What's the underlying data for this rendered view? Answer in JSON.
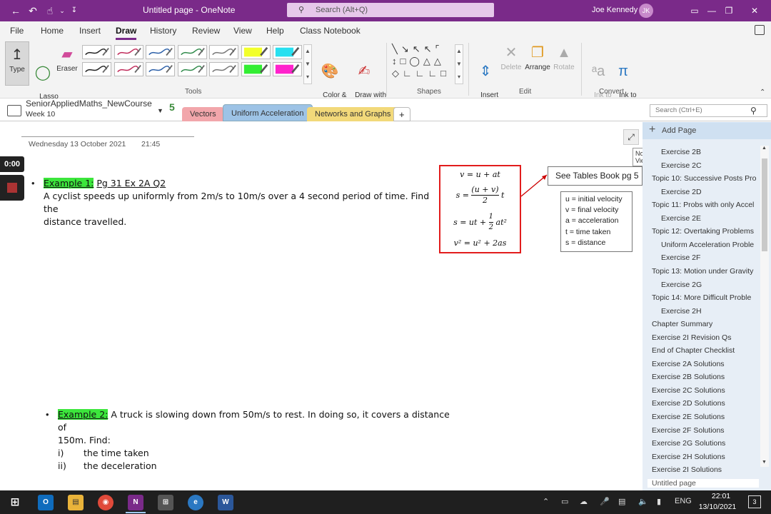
{
  "titlebar": {
    "title": "Untitled page  -  OneNote",
    "search_placeholder": "Search (Alt+Q)",
    "user": "Joe Kennedy",
    "initials": "JK"
  },
  "menu": {
    "tabs": [
      "File",
      "Home",
      "Insert",
      "Draw",
      "History",
      "Review",
      "View",
      "Help",
      "Class Notebook"
    ],
    "active": "Draw"
  },
  "ribbon": {
    "type": "Type",
    "lasso": "Lasso\nSelect",
    "eraser": "Eraser",
    "color_thickness": "Color &\nThickness",
    "draw_touch": "Draw with\nTouch",
    "insert_space": "Insert\nSpace",
    "delete": "Delete",
    "arrange": "Arrange",
    "rotate": "Rotate",
    "ink_text": "Ink to\nText",
    "ink_math": "Ink to\nMath",
    "groups": {
      "tools": "Tools",
      "shapes": "Shapes",
      "edit": "Edit",
      "convert": "Convert"
    }
  },
  "notebook": {
    "name": "SeniorAppliedMaths_NewCourse",
    "section": "Week 10",
    "sections": [
      "Vectors",
      "Uniform Acceleration",
      "Networks and Graphs"
    ],
    "active_section": "Uniform Acceleration",
    "search_placeholder": "Search (Ctrl+E)"
  },
  "page": {
    "date": "Wednesday 13 October 2021",
    "time": "21:45",
    "timer": "0:00",
    "tooltip": "Normal View",
    "example1": {
      "label": "Example 1:",
      "ref": "Pg 31 Ex 2A Q2",
      "line1": "A cyclist speeds up uniformly from 2m/s to 10m/s over a 4 second period of time. Find the",
      "line2": "distance travelled."
    },
    "example2": {
      "label": "Example 2:",
      "line1": "A truck is slowing down from 50m/s to rest. In doing so, it covers a distance of",
      "line2": "150m. Find:",
      "i": "i)",
      "i_text": "the time taken",
      "ii": "ii)",
      "ii_text": "the deceleration"
    },
    "tables": "See Tables Book pg 5",
    "legend": [
      "u = initial velocity",
      "v = final velocity",
      "a = acceleration",
      "t = time taken",
      "s = distance"
    ]
  },
  "pages": {
    "add": "Add Page",
    "items": [
      {
        "t": "Exercise 2B",
        "sub": true
      },
      {
        "t": "Exercise 2C",
        "sub": true
      },
      {
        "t": "Topic 10: Successive Posts Pro",
        "sub": false
      },
      {
        "t": "Exercise 2D",
        "sub": true
      },
      {
        "t": "Topic 11: Probs with only Accel",
        "sub": false
      },
      {
        "t": "Exercise 2E",
        "sub": true
      },
      {
        "t": "Topic 12: Overtaking Problems",
        "sub": false
      },
      {
        "t": "Uniform Acceleration Proble",
        "sub": true
      },
      {
        "t": "Exercise 2F",
        "sub": true
      },
      {
        "t": "Topic 13: Motion under Gravity",
        "sub": false
      },
      {
        "t": "Exercise 2G",
        "sub": true
      },
      {
        "t": "Topic 14: More Difficult Proble",
        "sub": false
      },
      {
        "t": "Exercise 2H",
        "sub": true
      },
      {
        "t": "Chapter Summary",
        "sub": false
      },
      {
        "t": "Exercise 2I Revision Qs",
        "sub": false
      },
      {
        "t": "End of Chapter Checklist",
        "sub": false
      },
      {
        "t": "Exercise 2A Solutions",
        "sub": false
      },
      {
        "t": "Exercise 2B Solutions",
        "sub": false
      },
      {
        "t": "Exercise 2C Solutions",
        "sub": false
      },
      {
        "t": "Exercise 2D Solutions",
        "sub": false
      },
      {
        "t": "Exercise 2E Solutions",
        "sub": false
      },
      {
        "t": "Exercise 2F Solutions",
        "sub": false
      },
      {
        "t": "Exercise 2G Solutions",
        "sub": false
      },
      {
        "t": "Exercise 2H Solutions",
        "sub": false
      },
      {
        "t": "Exercise 2I Solutions",
        "sub": false
      },
      {
        "t": "Untitled page",
        "sub": false
      }
    ]
  },
  "taskbar": {
    "lang": "ENG",
    "time": "22:01",
    "date": "13/10/2021",
    "notif": "3"
  }
}
